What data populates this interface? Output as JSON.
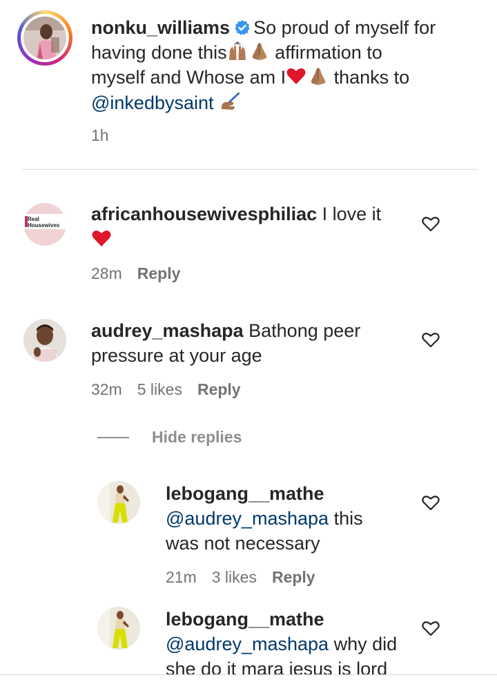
{
  "caption": {
    "username": "nonku_williams",
    "text_line1": "So proud of myself for",
    "text_line2_a": "having done this",
    "text_line2_b": "affirmation to",
    "text_line3_a": "myself and Whose am I",
    "text_line3_b": "thanks to",
    "mention": "@inkedbysaint",
    "time": "1h"
  },
  "comments": [
    {
      "username": "africanhousewivesphiliac",
      "text": "I love it",
      "avatar_text_1": "Real",
      "avatar_text_2": "Housewives",
      "time": "28m",
      "reply": "Reply"
    },
    {
      "username": "audrey_mashapa",
      "text_line1": "Bathong peer",
      "text_line2": "pressure at your age",
      "time": "32m",
      "likes": "5 likes",
      "reply": "Reply",
      "hide_replies": "Hide replies",
      "replies": [
        {
          "username": "lebogang__mathe",
          "mention": "@audrey_mashapa",
          "text_line1": "this",
          "text_line2": "was not necessary",
          "time": "21m",
          "likes": "3 likes",
          "reply": "Reply"
        },
        {
          "username": "lebogang__mathe",
          "mention": "@audrey_mashapa",
          "text_line1": "why did",
          "text_line2": "she do it mara iesus is lord"
        }
      ]
    }
  ],
  "colors": {
    "text": "#262626",
    "secondary": "#737373",
    "mention": "#00376b",
    "heart": "#e0162b",
    "verified": "#3897f0"
  },
  "icons": {
    "like": "heart-outline-icon",
    "verified": "verified-badge-icon",
    "emoji_raised_hands": "raised-hands-emoji",
    "emoji_praying": "folded-hands-emoji",
    "emoji_heart": "red-heart-emoji",
    "emoji_writing": "writing-hand-emoji"
  }
}
